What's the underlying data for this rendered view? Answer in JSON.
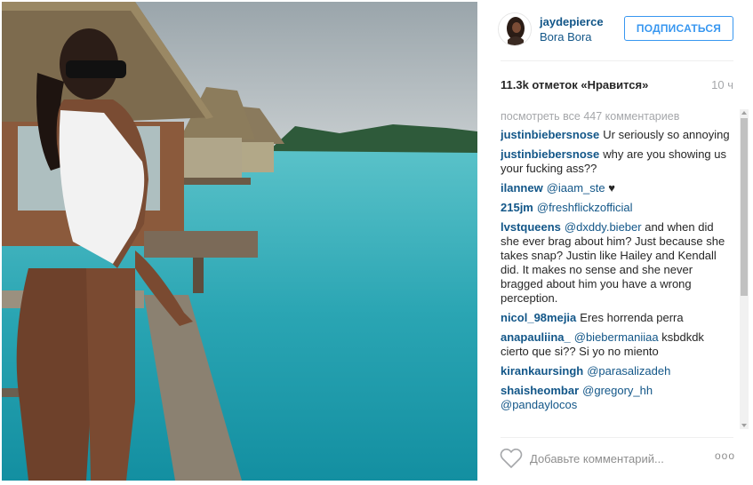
{
  "post": {
    "username": "jaydepierce",
    "location": "Bora Bora",
    "follow_label": "ПОДПИСАТЬСЯ",
    "likes": "11.3k отметок «Нравится»",
    "age": "10 ч"
  },
  "comments": {
    "view_all": "посмотреть все 447 комментариев",
    "items": [
      {
        "user": "justinbiebersnose",
        "mention": "",
        "text": "Ur seriously so annoying"
      },
      {
        "user": "justinbiebersnose",
        "mention": "",
        "text": "why are you showing us your fucking ass??"
      },
      {
        "user": "ilannew",
        "mention": "@iaam_ste",
        "text": "♥"
      },
      {
        "user": "215jm",
        "mention": "@freshflickzofficial",
        "text": ""
      },
      {
        "user": "lvstqueens",
        "mention": "@dxddy.bieber",
        "text": "and when did she ever brag about him? Just because she takes snap? Justin like Hailey and Kendall did. It makes no sense and she never bragged about him you have a wrong perception."
      },
      {
        "user": "nicol_98mejia",
        "mention": "",
        "text": "Eres horrenda perra"
      },
      {
        "user": "anapauliina_",
        "mention": "@biebermaniiaa",
        "text": "ksbdkdk cierto que si?? Si yo no miento"
      },
      {
        "user": "kirankaursingh",
        "mention": "@parasalizadeh",
        "text": ""
      },
      {
        "user": "shaisheombar",
        "mention": "@gregory_hh @pandaylocos",
        "text": ""
      }
    ]
  },
  "footer": {
    "add_comment_placeholder": "Добавьте комментарий...",
    "more_label": "ooo"
  },
  "icons": {
    "like": "heart-outline-icon",
    "more": "more-options-icon"
  },
  "colors": {
    "link": "#125688",
    "follow": "#3897f0",
    "muted": "#a5a7aa"
  }
}
